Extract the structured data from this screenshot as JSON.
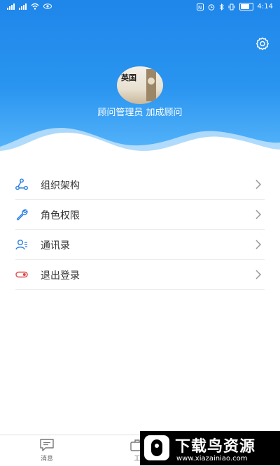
{
  "status_bar": {
    "time": "4:14"
  },
  "header": {
    "admin_text": "顾问管理员  加成顾问",
    "avatar_text": "英国"
  },
  "menu": {
    "items": [
      {
        "label": "组织架构",
        "icon": "org-structure-icon"
      },
      {
        "label": "角色权限",
        "icon": "wrench-icon"
      },
      {
        "label": "通讯录",
        "icon": "contacts-icon"
      },
      {
        "label": "退出登录",
        "icon": "toggle-logout-icon"
      }
    ]
  },
  "bottom_nav": {
    "items": [
      {
        "label": "消息"
      },
      {
        "label": "工"
      }
    ]
  },
  "watermark": {
    "title": "下载鸟资源",
    "url": "www.xiazainiao.com"
  },
  "colors": {
    "header_top": "#1f86ea",
    "header_bottom": "#5cb8fb",
    "accent_blue": "#2a7fe3",
    "logout_red": "#e14b4b"
  }
}
